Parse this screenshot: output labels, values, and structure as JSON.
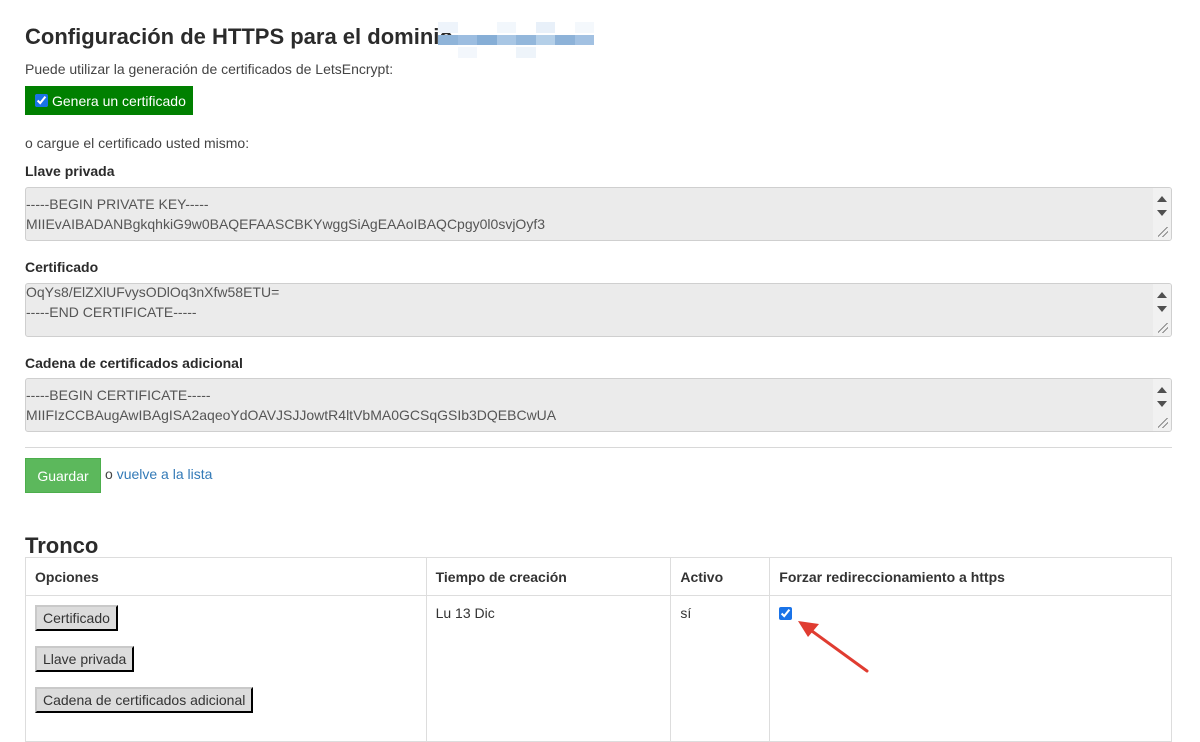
{
  "https": {
    "title": "Configuración de HTTPS para el dominio",
    "letsencrypt_text": "Puede utilizar la generación de certificados de LetsEncrypt:",
    "generate_label": "Genera un certificado",
    "generate_checked": true,
    "upload_text": "o cargue el certificado usted mismo:"
  },
  "fields": {
    "private_key": {
      "label": "Llave privada",
      "line1": "-----BEGIN PRIVATE KEY-----",
      "line2": "MIIEvAIBADANBgkqhkiG9w0BAQEFAASCBKYwggSiAgEAAoIBAQCpgy0l0svjOyf3"
    },
    "certificate": {
      "label": "Certificado",
      "line1": "OqYs8/ElZXlUFvysODlOq3nXfw58ETU=",
      "line2": "-----END CERTIFICATE-----"
    },
    "chain": {
      "label": "Cadena de certificados adicional",
      "line1": "-----BEGIN CERTIFICATE-----",
      "line2": "MIIFIzCCBAugAwIBAgISA2aqeoYdOAVJSJJowtR4ltVbMA0GCSqGSIb3DQEBCwUA"
    }
  },
  "actions": {
    "save_label": "Guardar",
    "or_text": "o",
    "back_label": "vuelve a la lista"
  },
  "log": {
    "title": "Tronco",
    "headers": [
      "Opciones",
      "Tiempo de creación",
      "Activo",
      "Forzar redireccionamiento a https"
    ],
    "row": {
      "buttons": [
        "Certificado",
        "Llave privada",
        "Cadena de certificados adicional"
      ],
      "created": "Lu 13 Dic",
      "active": "sí",
      "force_https": true
    }
  },
  "colors": {
    "generate_button": "#008000",
    "save_button": "#5cb85c",
    "link": "#337ab7",
    "annotation_arrow": "#e03c31"
  }
}
